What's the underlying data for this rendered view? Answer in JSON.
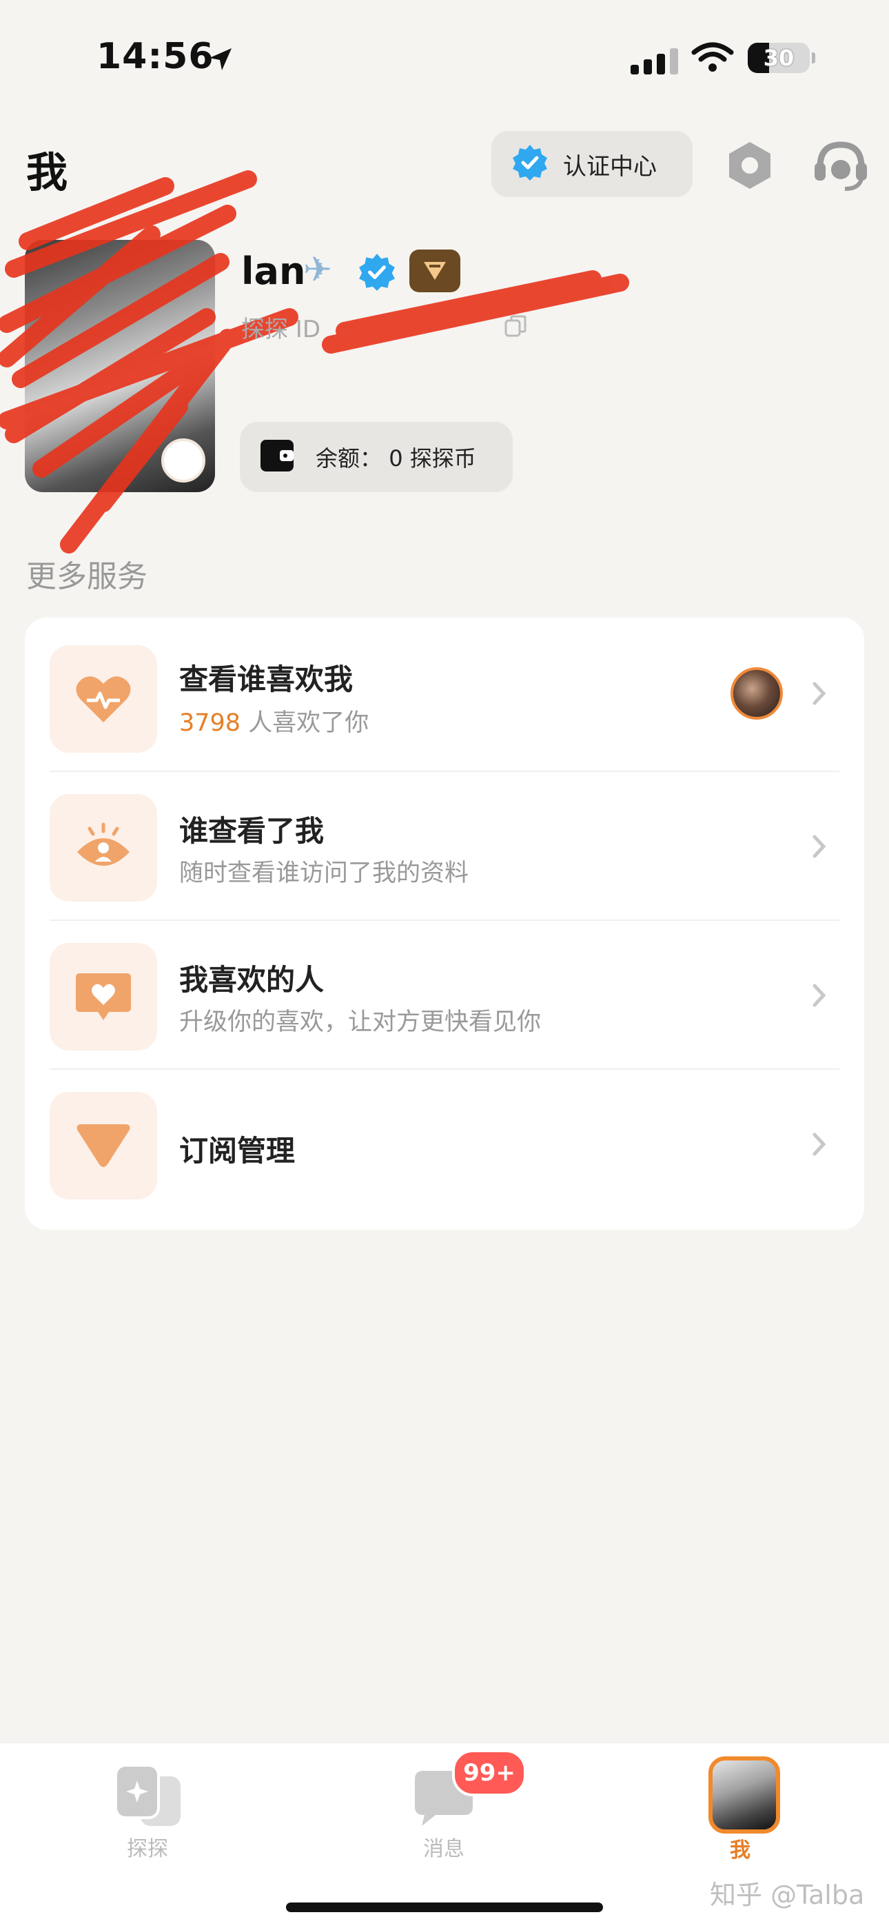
{
  "status_bar": {
    "time": "14:56",
    "battery": "30"
  },
  "header": {
    "title": "我",
    "verify_center": "认证中心"
  },
  "profile": {
    "name": "lan",
    "id_label": "探探 ID",
    "balance_label": "余额：",
    "balance_value": "0",
    "balance_unit": "探探币"
  },
  "section": {
    "title": "更多服务"
  },
  "services": [
    {
      "title": "查看谁喜欢我",
      "count": "3798",
      "subtitle": " 人喜欢了你"
    },
    {
      "title": "谁查看了我",
      "subtitle": "随时查看谁访问了我的资料"
    },
    {
      "title": "我喜欢的人",
      "subtitle": "升级你的喜欢，让对方更快看见你"
    },
    {
      "title": "订阅管理"
    }
  ],
  "tabs": [
    {
      "label": "探探",
      "icon": "swipe-cards-icon"
    },
    {
      "label": "消息",
      "icon": "chat-bubble-icon",
      "badge": "99+"
    },
    {
      "label": "我",
      "icon": "avatar"
    }
  ],
  "watermark": "知乎 @Talba",
  "colors": {
    "accent": "#e57f26",
    "verify_blue": "#2fa8f0",
    "badge_red": "#ff5a55"
  }
}
